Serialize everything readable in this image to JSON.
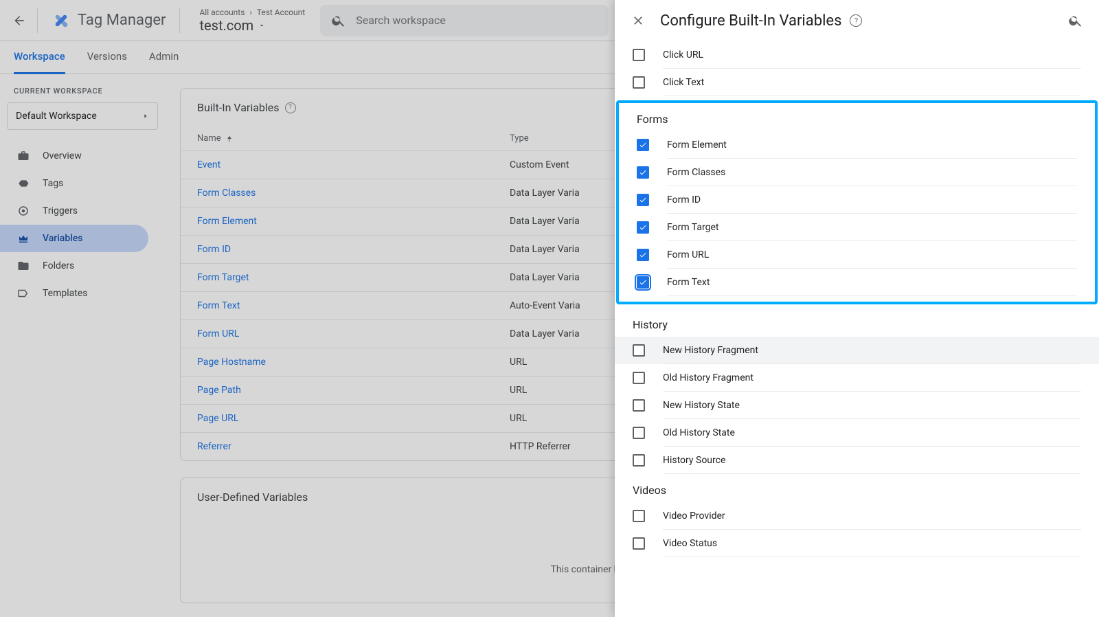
{
  "header": {
    "product": "Tag Manager",
    "breadcrumb": [
      "All accounts",
      "Test Account"
    ],
    "container": "test.com",
    "search_placeholder": "Search workspace"
  },
  "tabs": [
    "Workspace",
    "Versions",
    "Admin"
  ],
  "active_tab": "Workspace",
  "sidebar": {
    "section_label": "CURRENT WORKSPACE",
    "workspace_name": "Default Workspace",
    "items": [
      {
        "label": "Overview",
        "icon": "briefcase"
      },
      {
        "label": "Tags",
        "icon": "tag"
      },
      {
        "label": "Triggers",
        "icon": "target"
      },
      {
        "label": "Variables",
        "icon": "crown"
      },
      {
        "label": "Folders",
        "icon": "folder"
      },
      {
        "label": "Templates",
        "icon": "template"
      }
    ],
    "active": "Variables"
  },
  "builtin_card": {
    "title": "Built-In Variables",
    "col_name": "Name",
    "col_type": "Type",
    "rows": [
      {
        "name": "Event",
        "type": "Custom Event"
      },
      {
        "name": "Form Classes",
        "type": "Data Layer Varia"
      },
      {
        "name": "Form Element",
        "type": "Data Layer Varia"
      },
      {
        "name": "Form ID",
        "type": "Data Layer Varia"
      },
      {
        "name": "Form Target",
        "type": "Data Layer Varia"
      },
      {
        "name": "Form Text",
        "type": "Auto-Event Varia"
      },
      {
        "name": "Form URL",
        "type": "Data Layer Varia"
      },
      {
        "name": "Page Hostname",
        "type": "URL"
      },
      {
        "name": "Page Path",
        "type": "URL"
      },
      {
        "name": "Page URL",
        "type": "URL"
      },
      {
        "name": "Referrer",
        "type": "HTTP Referrer"
      }
    ]
  },
  "user_card": {
    "title": "User-Defined Variables",
    "empty_msg": "This container has no user-defined var"
  },
  "drawer": {
    "title": "Configure Built-In Variables",
    "groups": [
      {
        "name": "",
        "items": [
          {
            "label": "Click URL",
            "checked": false
          },
          {
            "label": "Click Text",
            "checked": false
          }
        ]
      },
      {
        "name": "Forms",
        "highlight": true,
        "items": [
          {
            "label": "Form Element",
            "checked": true
          },
          {
            "label": "Form Classes",
            "checked": true
          },
          {
            "label": "Form ID",
            "checked": true
          },
          {
            "label": "Form Target",
            "checked": true
          },
          {
            "label": "Form URL",
            "checked": true
          },
          {
            "label": "Form Text",
            "checked": true,
            "focus": true
          }
        ]
      },
      {
        "name": "History",
        "items": [
          {
            "label": "New History Fragment",
            "checked": false,
            "hover": true
          },
          {
            "label": "Old History Fragment",
            "checked": false
          },
          {
            "label": "New History State",
            "checked": false
          },
          {
            "label": "Old History State",
            "checked": false
          },
          {
            "label": "History Source",
            "checked": false
          }
        ]
      },
      {
        "name": "Videos",
        "items": [
          {
            "label": "Video Provider",
            "checked": false
          },
          {
            "label": "Video Status",
            "checked": false
          }
        ]
      }
    ]
  }
}
